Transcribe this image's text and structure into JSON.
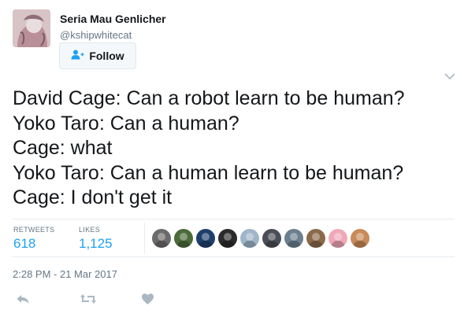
{
  "author": {
    "display_name": "Seria Mau Genlicher",
    "handle": "@kshipwhitecat"
  },
  "follow_button": {
    "label": "Follow",
    "icon": "add-user-icon"
  },
  "tweet": {
    "lines": [
      "David Cage: Can a robot learn to be human?",
      "Yoko Taro: Can a human?",
      "Cage: what",
      "Yoko Taro: Can a human learn to be human?",
      "Cage: I don't get it"
    ]
  },
  "stats": {
    "retweets_label": "RETWEETS",
    "retweets_value": "618",
    "likes_label": "LIKES",
    "likes_value": "1,125"
  },
  "liker_avatars": [
    {
      "name": "liker-avatar-1",
      "color": "#6b6b6b"
    },
    {
      "name": "liker-avatar-2",
      "color": "#4a6b3a"
    },
    {
      "name": "liker-avatar-3",
      "color": "#1f3f6b"
    },
    {
      "name": "liker-avatar-4",
      "color": "#2b2b2b"
    },
    {
      "name": "liker-avatar-5",
      "color": "#9fb6c9"
    },
    {
      "name": "liker-avatar-6",
      "color": "#4a4f57"
    },
    {
      "name": "liker-avatar-7",
      "color": "#6b7f8f"
    },
    {
      "name": "liker-avatar-8",
      "color": "#8a6a4a"
    },
    {
      "name": "liker-avatar-9",
      "color": "#f0a8b8"
    },
    {
      "name": "liker-avatar-10",
      "color": "#c98a5a"
    }
  ],
  "timestamp": "2:28 PM - 21 Mar 2017",
  "actions": {
    "reply_icon": "reply-icon",
    "retweet_icon": "retweet-icon",
    "like_icon": "heart-icon"
  },
  "colors": {
    "accent": "#1da1f2",
    "text_primary": "#14171a",
    "text_secondary": "#657786",
    "icon_muted": "#aab8c2"
  }
}
